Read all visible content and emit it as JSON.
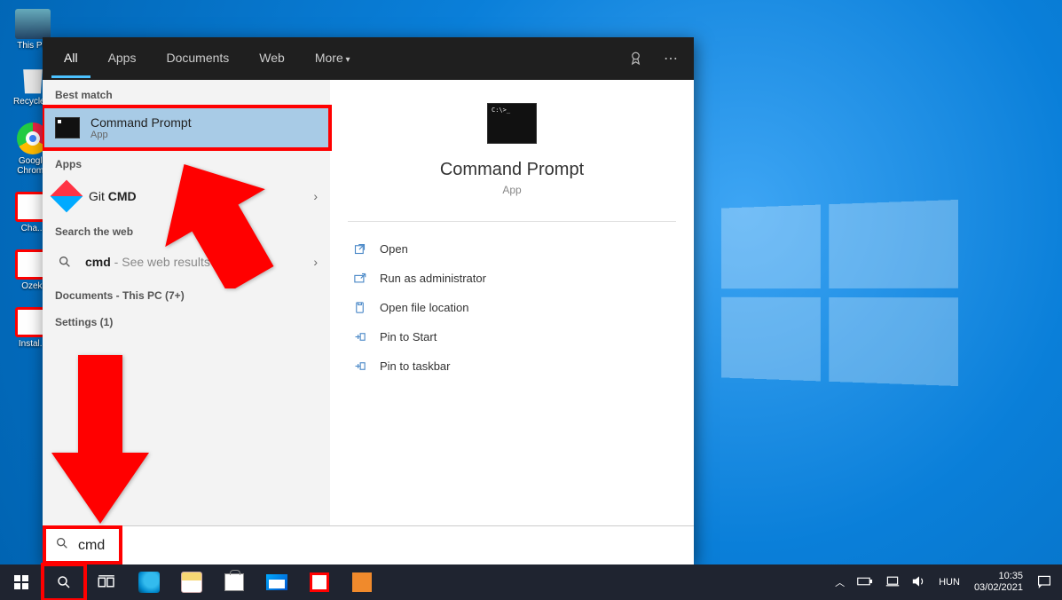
{
  "desktop": {
    "icons": [
      {
        "label": "This PC"
      },
      {
        "label": "Recycle..."
      },
      {
        "label": "Google Chrome"
      },
      {
        "label": "Cha..."
      },
      {
        "label": "Ozeki"
      },
      {
        "label": "Instal..."
      }
    ]
  },
  "search_panel": {
    "tabs": {
      "all": "All",
      "apps": "Apps",
      "documents": "Documents",
      "web": "Web",
      "more": "More"
    },
    "sections": {
      "best_match": "Best match",
      "apps": "Apps",
      "search_web": "Search the web",
      "documents": "Documents - This PC (7+)",
      "settings": "Settings (1)"
    },
    "best_match_item": {
      "title": "Command Prompt",
      "subtitle": "App"
    },
    "apps_item": {
      "prefix": "Git ",
      "bold": "CMD"
    },
    "web_item": {
      "term": "cmd",
      "suffix": " - See web results"
    },
    "preview": {
      "name": "Command Prompt",
      "type": "App",
      "actions": {
        "open": "Open",
        "run_admin": "Run as administrator",
        "open_loc": "Open file location",
        "pin_start": "Pin to Start",
        "pin_taskbar": "Pin to taskbar"
      }
    },
    "search_value": "cmd"
  },
  "taskbar": {
    "lang": "HUN",
    "time": "10:35",
    "date": "03/02/2021"
  }
}
